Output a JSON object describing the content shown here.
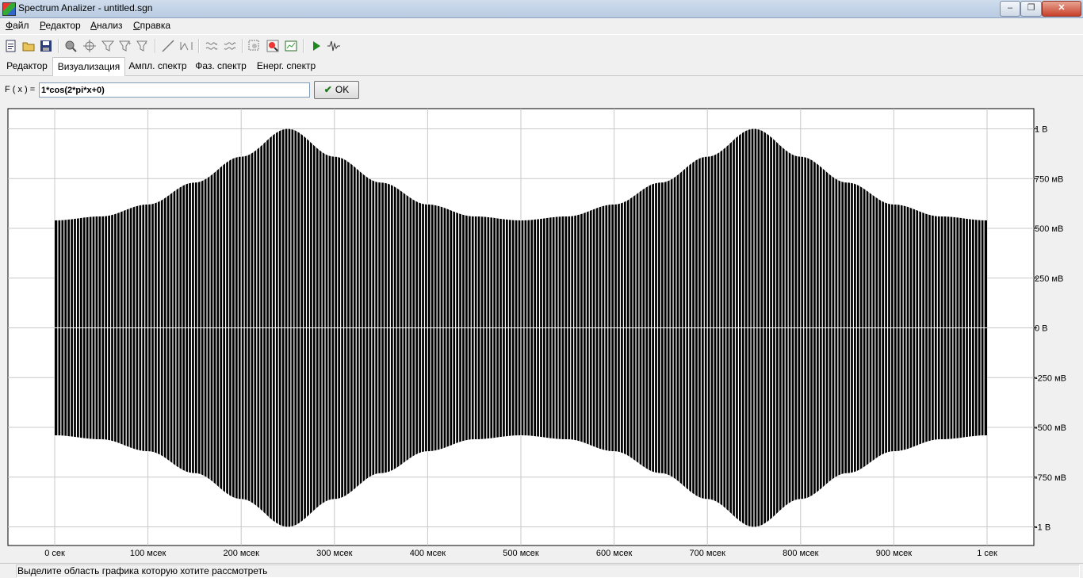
{
  "window": {
    "title": "Spectrum Analizer - untitled.sgn",
    "controls": [
      "–",
      "❐",
      "✕"
    ]
  },
  "menu": [
    "Файл",
    "Редактор",
    "Анализ",
    "Справка"
  ],
  "toolbar": {
    "icons": [
      "new-file-icon",
      "open-folder-icon",
      "save-icon",
      "zoom-icon",
      "crosshair-icon",
      "filter-icon",
      "filter-plus-icon",
      "filter-minus-icon",
      "line-icon",
      "peaks-icon",
      "signal-sum-icon",
      "signal-diff-icon",
      "zoom-region-icon",
      "zoom-reset-icon",
      "window-graph-icon",
      "play-icon",
      "waveform-icon"
    ]
  },
  "tabs": [
    "Редактор",
    "Визуализация",
    "Ампл. спектр",
    "Фаз. спектр",
    "Енерг. спектр"
  ],
  "active_tab": 1,
  "formula": {
    "label": "F ( x ) =",
    "value": "1*cos(2*pi*x+0)",
    "ok_label": "OK"
  },
  "status": "Выделите область графика которую хотите рассмотреть",
  "colors": {
    "plot": "#000000",
    "grid": "#c8c8c8",
    "background": "#ffffff"
  },
  "chart_data": {
    "type": "line",
    "title": "",
    "xlabel": "",
    "ylabel": "",
    "xlim": [
      0,
      1
    ],
    "ylim": [
      -1,
      1
    ],
    "grid": true,
    "x_tick_values": [
      0,
      0.1,
      0.2,
      0.3,
      0.4,
      0.5,
      0.6,
      0.7,
      0.8,
      0.9,
      1
    ],
    "x_tick_labels": [
      "0 сек",
      "100 мсек",
      "200 мсек",
      "300 мсек",
      "400 мсек",
      "500 мсек",
      "600 мсек",
      "700 мсек",
      "800 мсек",
      "900 мсек",
      "1 сек"
    ],
    "y_tick_values": [
      1,
      0.75,
      0.5,
      0.25,
      0,
      -0.25,
      -0.5,
      -0.75,
      -1
    ],
    "y_tick_labels": [
      "1 В",
      "750 мВ",
      "500 мВ",
      "250 мВ",
      "0 В",
      "-250 мВ",
      "-500 мВ",
      "-750 мВ",
      "-1 В"
    ],
    "series": [
      {
        "envelope_x": [
          0,
          0.05,
          0.1,
          0.15,
          0.2,
          0.25,
          0.3,
          0.35,
          0.4,
          0.45,
          0.5,
          0.55,
          0.6,
          0.65,
          0.7,
          0.75,
          0.8,
          0.85,
          0.9,
          0.95,
          1
        ],
        "envelope_y": [
          0.54,
          0.56,
          0.62,
          0.73,
          0.86,
          1.0,
          0.86,
          0.73,
          0.62,
          0.56,
          0.54,
          0.56,
          0.62,
          0.73,
          0.86,
          1.0,
          0.86,
          0.73,
          0.62,
          0.56,
          0.54
        ],
        "stripe_count": 300
      }
    ]
  }
}
